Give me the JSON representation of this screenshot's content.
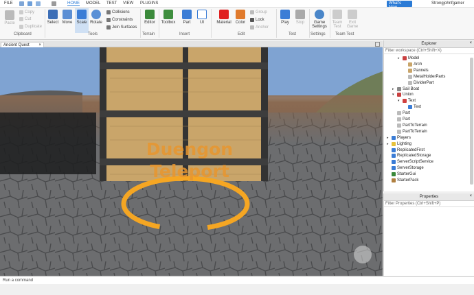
{
  "menubar": {
    "file": "FILE",
    "home": "HOME",
    "model": "MODEL",
    "test": "TEST",
    "view": "VIEW",
    "plugins": "PLUGINS",
    "whats_new": "What's New",
    "user": "Strongjohnfgamer"
  },
  "ribbon": {
    "clipboard": {
      "paste": "Paste",
      "copy": "Copy",
      "cut": "Cut",
      "duplicate": "Duplicate",
      "group": "Clipboard"
    },
    "tools": {
      "select": "Select",
      "move": "Move",
      "scale": "Scale",
      "rotate": "Rotate",
      "collisions": "Collisions",
      "constraints": "Constraints",
      "join_surfaces": "Join Surfaces",
      "group": "Tools"
    },
    "terrain": {
      "editor": "Editor",
      "group": "Terrain"
    },
    "insert": {
      "toolbox": "Toolbox",
      "part": "Part",
      "ui": "UI",
      "group": "Insert"
    },
    "edit": {
      "material": "Material",
      "color": "Color",
      "group_btn": "Group",
      "lock": "Lock",
      "anchor": "Anchor",
      "group": "Edit"
    },
    "test": {
      "play": "Play",
      "stop": "Stop",
      "group": "Test"
    },
    "settings": {
      "game_settings": "Game Settings",
      "group": "Settings"
    },
    "team_test": {
      "team_test": "Team Test",
      "exit_game": "Exit Game",
      "group": "Team Test"
    }
  },
  "document_tab": {
    "label": "Ancient Quest",
    "close": "×"
  },
  "viewport": {
    "sign_line1": "Duengon",
    "sign_line2": "Teleport"
  },
  "explorer": {
    "title": "Explorer",
    "filter_placeholder": "Filter workspace (Ctrl+Shift+X)",
    "items": [
      "Model",
      "Arch",
      "Pannels",
      "MetalHolderParts",
      "DividerPart",
      "Sail Boat",
      "Union",
      "Text",
      "Text",
      "Part",
      "Part",
      "PartToTerrain",
      "PartToTerrain",
      "Players",
      "Lighting",
      "ReplicatedFirst",
      "ReplicatedStorage",
      "ServerScriptService",
      "ServerStorage",
      "StarterGui",
      "StarterPack"
    ]
  },
  "properties": {
    "title": "Properties",
    "filter_placeholder": "Filter Properties (Ctrl+Shift+P)"
  },
  "command_bar": {
    "placeholder": "Run a command"
  },
  "colors": {
    "accent": "#2b7bd6",
    "sign_text": "#e8962f",
    "ring": "#f5a623"
  }
}
